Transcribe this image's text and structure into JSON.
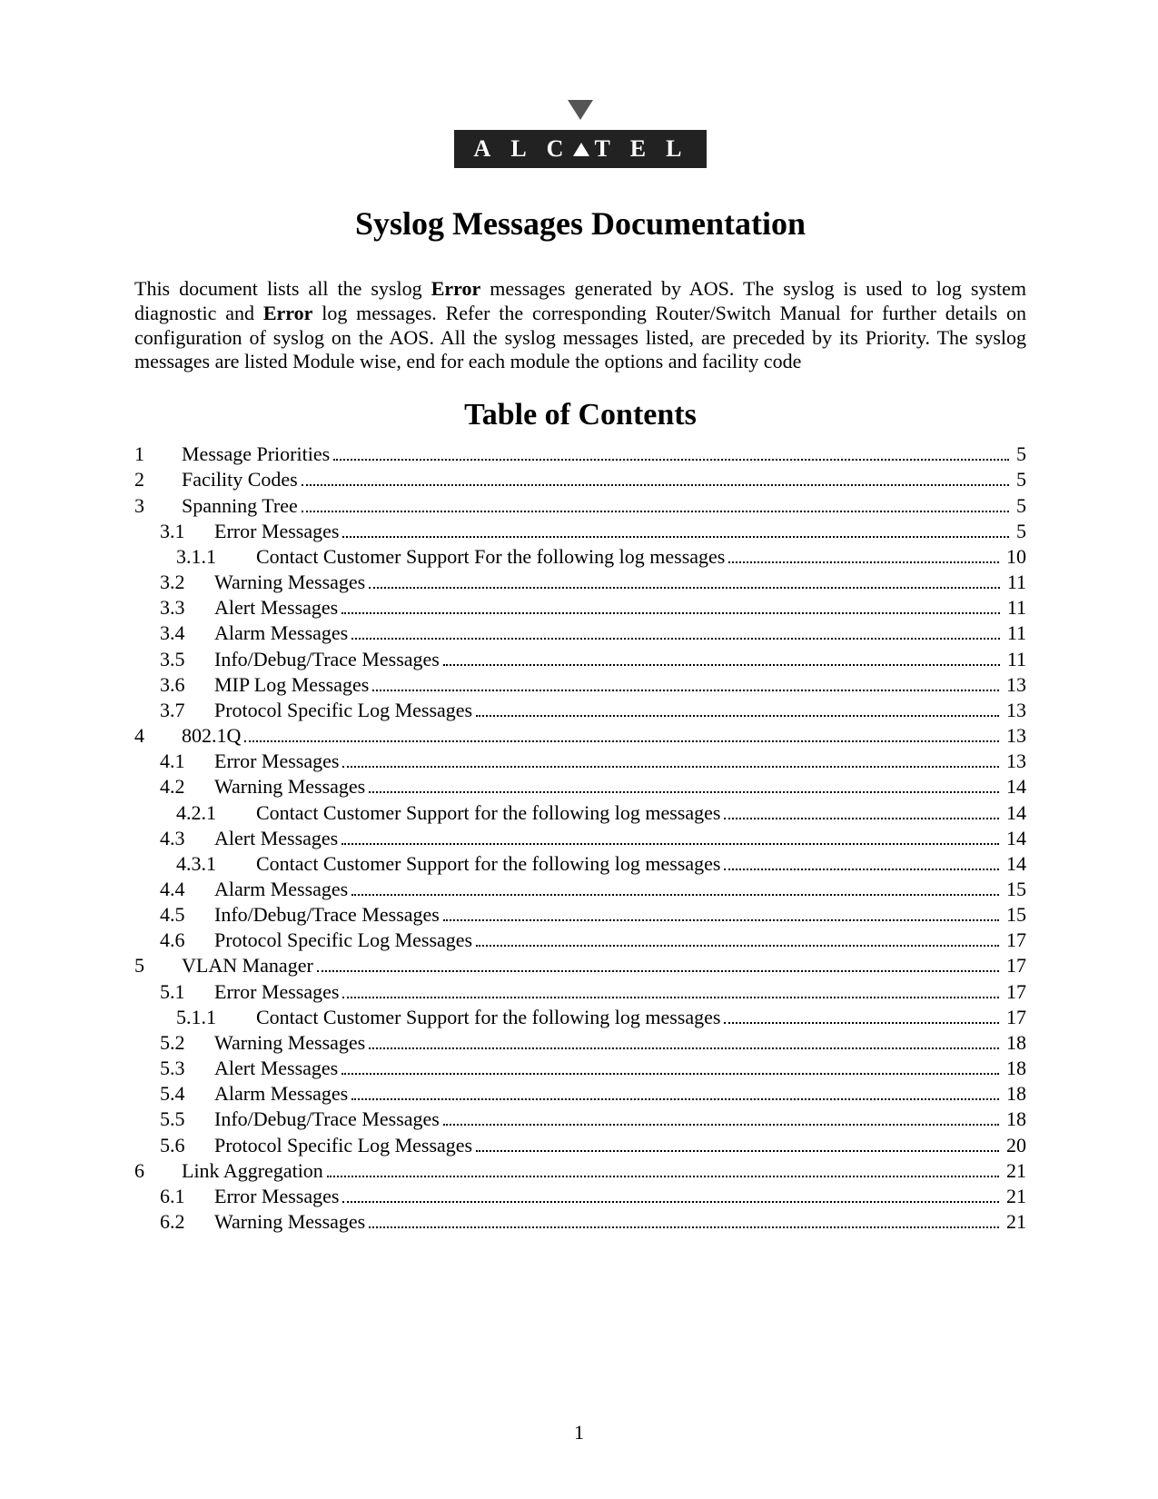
{
  "logo_text": "ALCATEL",
  "title": "Syslog Messages Documentation",
  "intro_parts": {
    "p1": "This document lists all the syslog ",
    "b1": "Error",
    "p2": " messages generated by AOS. The syslog is used to log system diagnostic and ",
    "b2": "Error",
    "p3": " log messages. Refer the corresponding Router/Switch Manual for further details on configuration of syslog on the AOS. All the syslog messages listed, are preceded by its Priority. The syslog messages are listed Module wise, end for each module the options and facility code"
  },
  "toc_title": "Table of Contents",
  "page_number": "1",
  "toc": [
    {
      "level": 1,
      "num": "1",
      "title": "Message Priorities",
      "page": "5"
    },
    {
      "level": 1,
      "num": "2",
      "title": "Facility Codes",
      "page": "5"
    },
    {
      "level": 1,
      "num": "3",
      "title": "Spanning Tree",
      "page": "5"
    },
    {
      "level": 2,
      "num": "3.1",
      "title": "Error Messages",
      "page": "5"
    },
    {
      "level": 3,
      "num": "3.1.1",
      "title": "Contact Customer Support For the following log messages",
      "page": "10"
    },
    {
      "level": 2,
      "num": "3.2",
      "title": "Warning Messages",
      "page": "11"
    },
    {
      "level": 2,
      "num": "3.3",
      "title": "Alert Messages",
      "page": "11"
    },
    {
      "level": 2,
      "num": "3.4",
      "title": "Alarm Messages",
      "page": "11"
    },
    {
      "level": 2,
      "num": "3.5",
      "title": "Info/Debug/Trace Messages",
      "page": "11"
    },
    {
      "level": 2,
      "num": "3.6",
      "title": "MIP Log Messages",
      "page": "13"
    },
    {
      "level": 2,
      "num": "3.7",
      "title": "Protocol Specific Log Messages",
      "page": "13"
    },
    {
      "level": 1,
      "num": "4",
      "title": "802.1Q",
      "page": "13"
    },
    {
      "level": 2,
      "num": "4.1",
      "title": "Error Messages",
      "page": "13"
    },
    {
      "level": 2,
      "num": "4.2",
      "title": "Warning Messages",
      "page": "14"
    },
    {
      "level": 3,
      "num": "4.2.1",
      "title": "Contact Customer Support for the following log messages",
      "page": "14"
    },
    {
      "level": 2,
      "num": "4.3",
      "title": "Alert Messages",
      "page": "14"
    },
    {
      "level": 3,
      "num": "4.3.1",
      "title": "Contact Customer Support for the following log messages",
      "page": "14"
    },
    {
      "level": 2,
      "num": "4.4",
      "title": "Alarm Messages",
      "page": "15"
    },
    {
      "level": 2,
      "num": "4.5",
      "title": "Info/Debug/Trace Messages",
      "page": "15"
    },
    {
      "level": 2,
      "num": "4.6",
      "title": "Protocol Specific Log Messages",
      "page": "17"
    },
    {
      "level": 1,
      "num": "5",
      "title": "VLAN Manager",
      "page": "17"
    },
    {
      "level": 2,
      "num": "5.1",
      "title": "Error Messages",
      "page": "17"
    },
    {
      "level": 3,
      "num": "5.1.1",
      "title": "Contact Customer Support for the following log messages",
      "page": "17"
    },
    {
      "level": 2,
      "num": "5.2",
      "title": "Warning Messages",
      "page": "18"
    },
    {
      "level": 2,
      "num": "5.3",
      "title": "Alert Messages",
      "page": "18"
    },
    {
      "level": 2,
      "num": "5.4",
      "title": "Alarm Messages",
      "page": "18"
    },
    {
      "level": 2,
      "num": "5.5",
      "title": "Info/Debug/Trace Messages",
      "page": "18"
    },
    {
      "level": 2,
      "num": "5.6",
      "title": "Protocol Specific Log Messages",
      "page": "20"
    },
    {
      "level": 1,
      "num": "6",
      "title": "Link Aggregation",
      "page": "21"
    },
    {
      "level": 2,
      "num": "6.1",
      "title": "Error Messages",
      "page": "21"
    },
    {
      "level": 2,
      "num": "6.2",
      "title": "Warning Messages",
      "page": "21"
    }
  ]
}
